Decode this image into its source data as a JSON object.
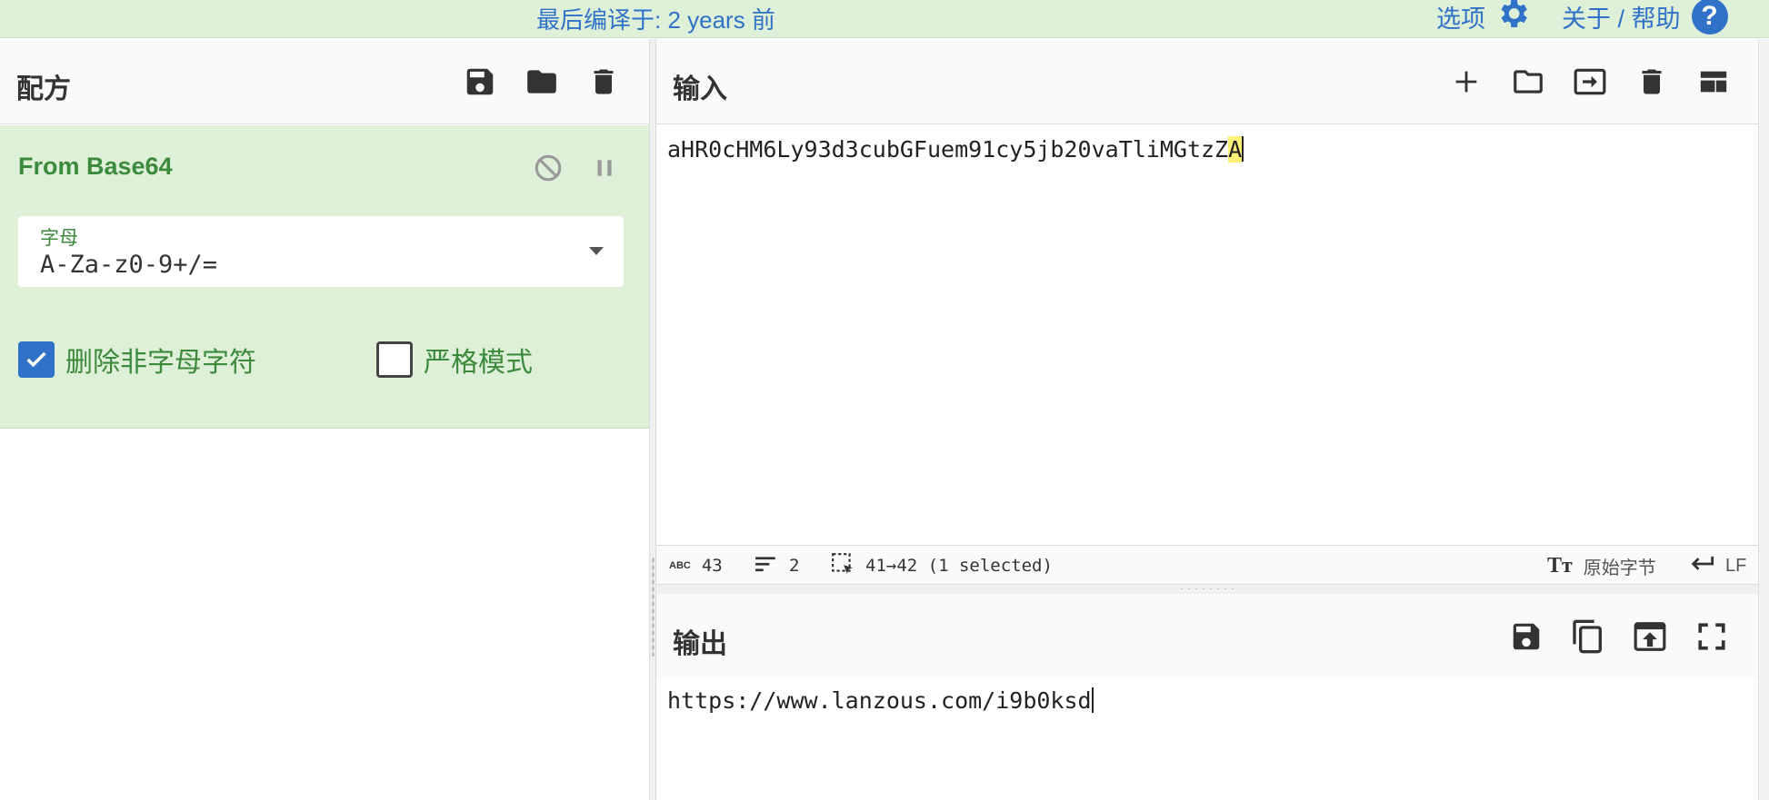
{
  "topbar": {
    "compiled": "最后编译于: 2 years 前",
    "options_label": "选项",
    "about_label": "关于 / 帮助",
    "help_glyph": "?"
  },
  "recipe": {
    "title": "配方",
    "operation": {
      "name": "From Base64",
      "alphabet_label": "字母",
      "alphabet_value": "A-Za-z0-9+/=",
      "remove_non_alpha_label": "删除非字母字符",
      "remove_non_alpha_checked": true,
      "strict_mode_label": "严格模式",
      "strict_mode_checked": false
    }
  },
  "input": {
    "title": "输入",
    "text_main": "aHR0cHM6Ly93d3cubGFuem91cy5jb20vaTliMGtzZ",
    "text_selected": "A",
    "status": {
      "abc_icon": "ABC",
      "char_count": "43",
      "line_count": "2",
      "selection": "41→42 (1 selected)",
      "encoding": "原始字节",
      "eol": "LF"
    }
  },
  "output": {
    "title": "输出",
    "text": "https://www.lanzous.com/i9b0ksd"
  },
  "colors": {
    "accent_blue": "#2f72c8",
    "op_green_bg": "#dff0d8",
    "op_green_text": "#3c8a3c",
    "highlight": "#fff176"
  }
}
